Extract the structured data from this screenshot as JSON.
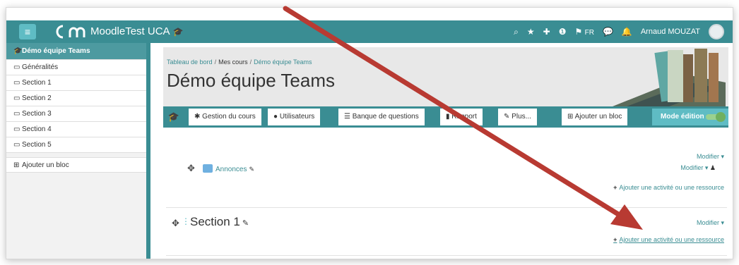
{
  "navbar": {
    "menu_icon": "hamburger-icon",
    "site_name": "MoodleTest UCA",
    "site_hat": "🎓",
    "search_icon": "⌕",
    "star_icon": "★",
    "plus_icon": "✚",
    "info_icon": "❶",
    "flag_icon": "⚑",
    "lang": "FR",
    "chat_icon": "💬",
    "bell_icon": "🔔",
    "user_name": "Arnaud MOUZAT",
    "colors": {
      "bar": "#3a8d93",
      "accent": "#5fbcc4"
    }
  },
  "sidebar": {
    "items": [
      {
        "label": "Démo équipe Teams",
        "icon": "🎓"
      },
      {
        "label": "Généralités",
        "icon": "▭"
      },
      {
        "label": "Section 1",
        "icon": "▭"
      },
      {
        "label": "Section 2",
        "icon": "▭"
      },
      {
        "label": "Section 3",
        "icon": "▭"
      },
      {
        "label": "Section 4",
        "icon": "▭"
      },
      {
        "label": "Section 5",
        "icon": "▭"
      }
    ],
    "add_block": {
      "label": "Ajouter un bloc",
      "icon": "⊞"
    }
  },
  "header": {
    "breadcrumb": [
      "Tableau de bord",
      "Mes cours",
      "Démo équipe Teams"
    ],
    "breadcrumb_sep": "/",
    "title": "Démo équipe Teams"
  },
  "course_nav": {
    "home_icon": "🎓",
    "items": [
      {
        "label": "Gestion du cours",
        "icon": "✱"
      },
      {
        "label": "Utilisateurs",
        "icon": "●"
      },
      {
        "label": "Banque de questions",
        "icon": "☰"
      },
      {
        "label": "Rapport",
        "icon": "▮"
      },
      {
        "label": "Plus...",
        "icon": "✎"
      },
      {
        "label": "Ajouter un bloc",
        "icon": "⊞"
      }
    ],
    "mode_edition": "Mode édition"
  },
  "content": {
    "section0": {
      "move_icon": "✥",
      "activity": "Annonces",
      "pencil": "✎",
      "modifier_section": "Modifier ▾",
      "modifier_activity": "Modifier ▾",
      "person_icon": "♟",
      "add_activity": "Ajouter une activité ou une ressource",
      "plus": "+"
    },
    "section1": {
      "move_icon": "✥",
      "title": "Section 1",
      "pencil": "✎",
      "modifier": "Modifier ▾",
      "add_activity": "Ajouter une activité ou une ressource",
      "plus": "+"
    }
  },
  "annotation": {
    "arrow_color": "#c0392b"
  }
}
